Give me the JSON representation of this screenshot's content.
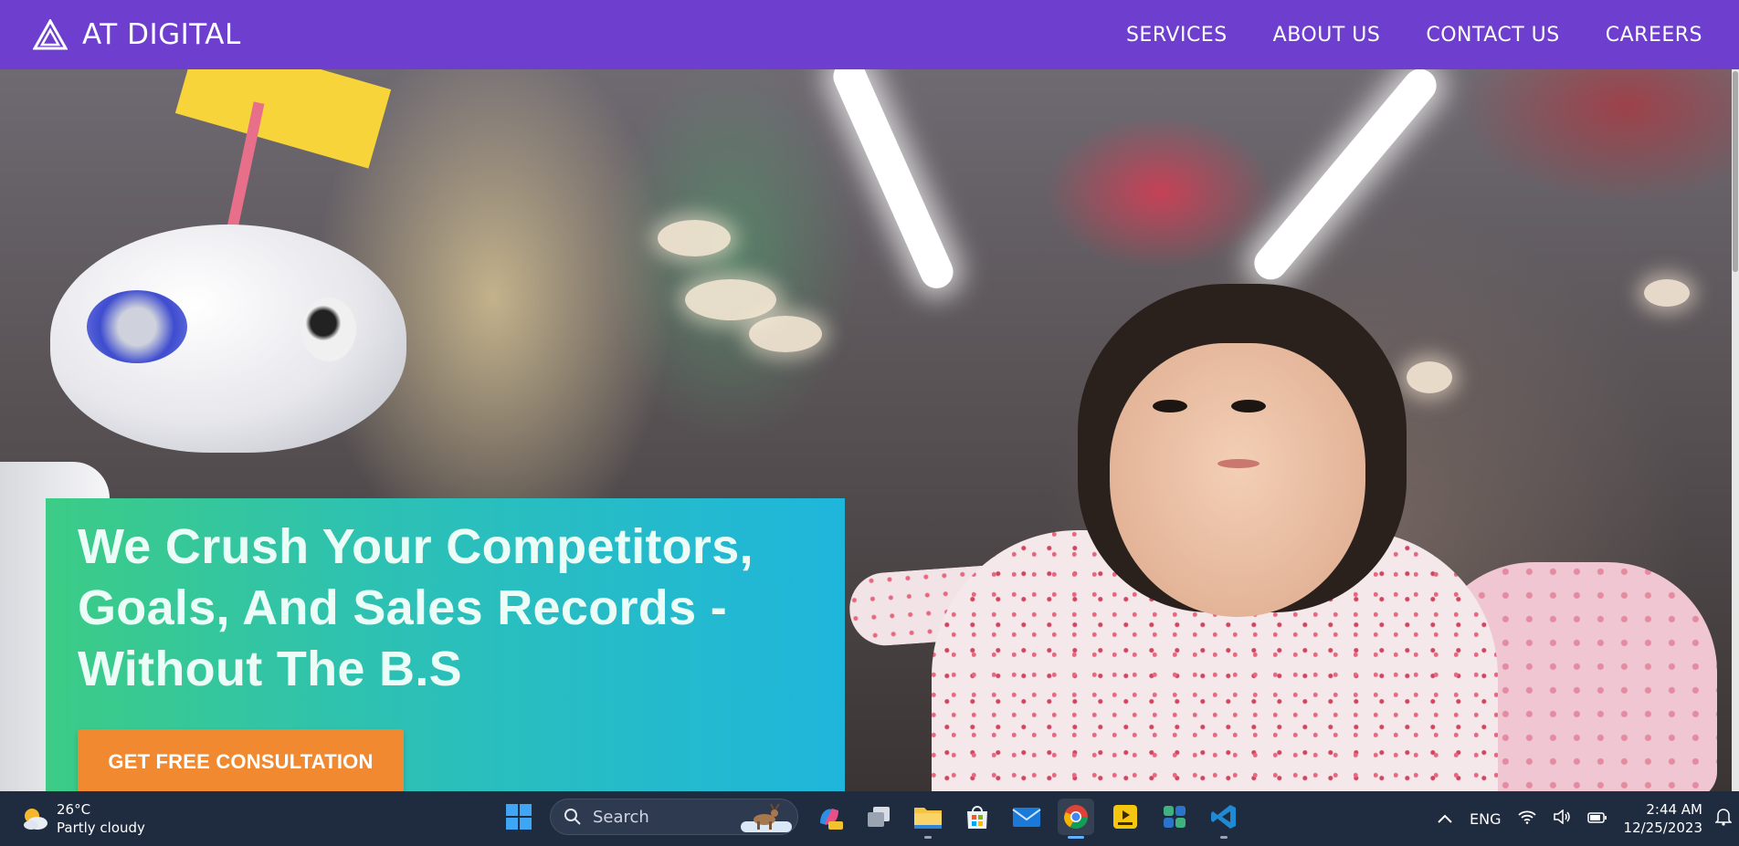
{
  "nav": {
    "brand": "AT DIGITAL",
    "links": [
      "SERVICES",
      "ABOUT US",
      "CONTACT US",
      "CAREERS"
    ],
    "background": "#6e3fcf"
  },
  "hero": {
    "title": "We Crush Your Competitors, Goals, And Sales Records - Without The B.S",
    "cta": "GET FREE CONSULTATION",
    "card_gradient": [
      "#3ccc86",
      "#1fb6dc"
    ],
    "cta_color": "#f0892f"
  },
  "taskbar": {
    "weather": {
      "temp": "26°C",
      "condition": "Partly cloudy",
      "icon": "partly-cloudy-icon"
    },
    "search_placeholder": "Search",
    "apps": [
      "start-icon",
      "search",
      "copilot-icon",
      "task-view-icon",
      "file-explorer-icon",
      "store-icon",
      "mail-icon",
      "chrome-icon",
      "player-icon",
      "app-icon",
      "vscode-icon"
    ],
    "tray": {
      "language": "ENG",
      "time": "2:44 AM",
      "date": "12/25/2023"
    }
  }
}
